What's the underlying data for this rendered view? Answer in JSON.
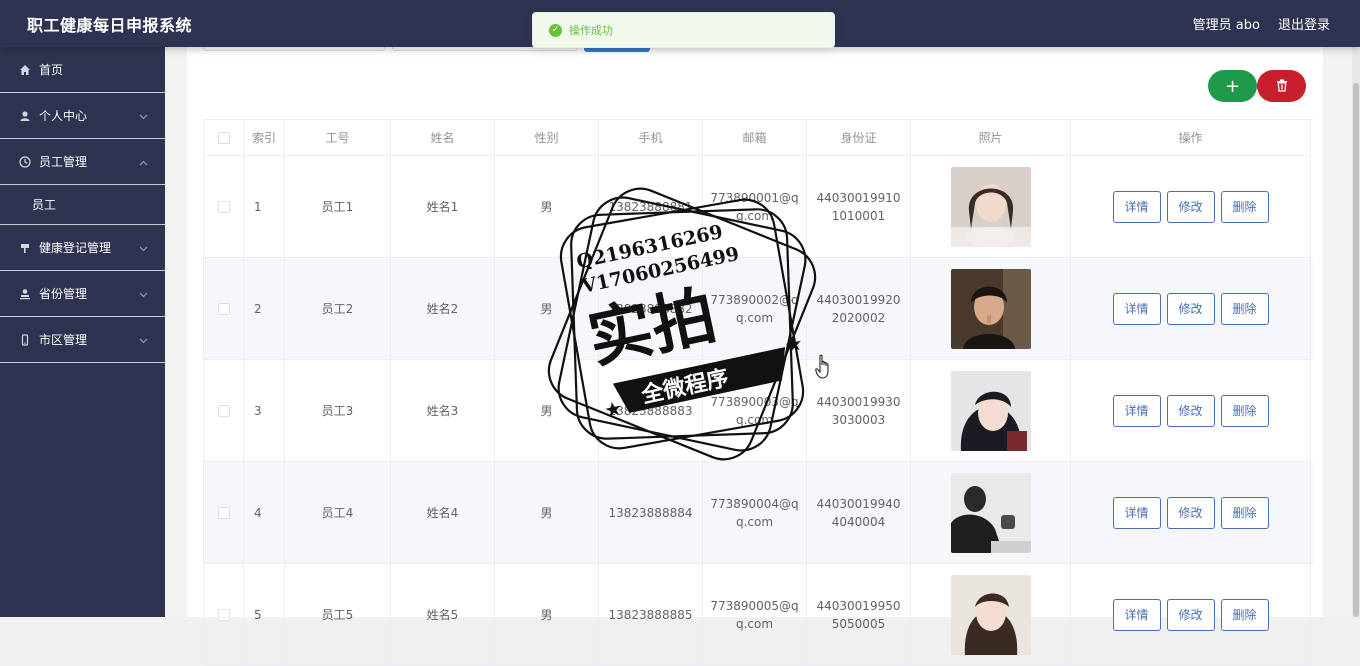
{
  "app": {
    "title": "职工健康每日申报系统"
  },
  "header": {
    "user_label": "管理员 abo",
    "logout_label": "退出登录"
  },
  "sidebar": {
    "items": [
      {
        "label": "首页",
        "icon": "home-icon"
      },
      {
        "label": "个人中心",
        "icon": "user-icon"
      },
      {
        "label": "员工管理",
        "icon": "clock-icon",
        "expanded": true,
        "children": [
          {
            "label": "员工"
          }
        ]
      },
      {
        "label": "健康登记管理",
        "icon": "flag-icon"
      },
      {
        "label": "省份管理",
        "icon": "person-icon"
      },
      {
        "label": "市区管理",
        "icon": "phone-icon"
      }
    ]
  },
  "toast": {
    "text": "操作成功",
    "color": "#67c23a"
  },
  "toolbar": {
    "add_label": "+",
    "delete_icon": "trash-icon"
  },
  "table": {
    "headers": [
      "索引",
      "工号",
      "姓名",
      "性别",
      "手机",
      "邮箱",
      "身份证",
      "照片",
      "操作"
    ],
    "rows": [
      {
        "index": "1",
        "no": "员工1",
        "name": "姓名1",
        "sex": "男",
        "phone": "13823888881",
        "email": "773890001@qq.com",
        "idcard": "440300199101010001"
      },
      {
        "index": "2",
        "no": "员工2",
        "name": "姓名2",
        "sex": "男",
        "phone": "13823888882",
        "email": "773890002@qq.com",
        "idcard": "440300199202020002"
      },
      {
        "index": "3",
        "no": "员工3",
        "name": "姓名3",
        "sex": "男",
        "phone": "13823888883",
        "email": "773890003@qq.com",
        "idcard": "440300199303030003"
      },
      {
        "index": "4",
        "no": "员工4",
        "name": "姓名4",
        "sex": "男",
        "phone": "13823888884",
        "email": "773890004@qq.com",
        "idcard": "440300199404040004"
      },
      {
        "index": "5",
        "no": "员工5",
        "name": "姓名5",
        "sex": "男",
        "phone": "13823888885",
        "email": "773890005@qq.com",
        "idcard": "440300199505050005"
      }
    ],
    "actions": {
      "detail": "详情",
      "edit": "修改",
      "delete": "删除"
    }
  },
  "watermark": {
    "line1": "Q2196316269",
    "line2": "V17060256499",
    "big": "实拍",
    "banner": "全微程序"
  },
  "colors": {
    "header_bg": "#2f3352",
    "add_btn": "#1f9a4a",
    "delete_btn": "#c71f2d",
    "action_btn": "#4a6fb5"
  }
}
